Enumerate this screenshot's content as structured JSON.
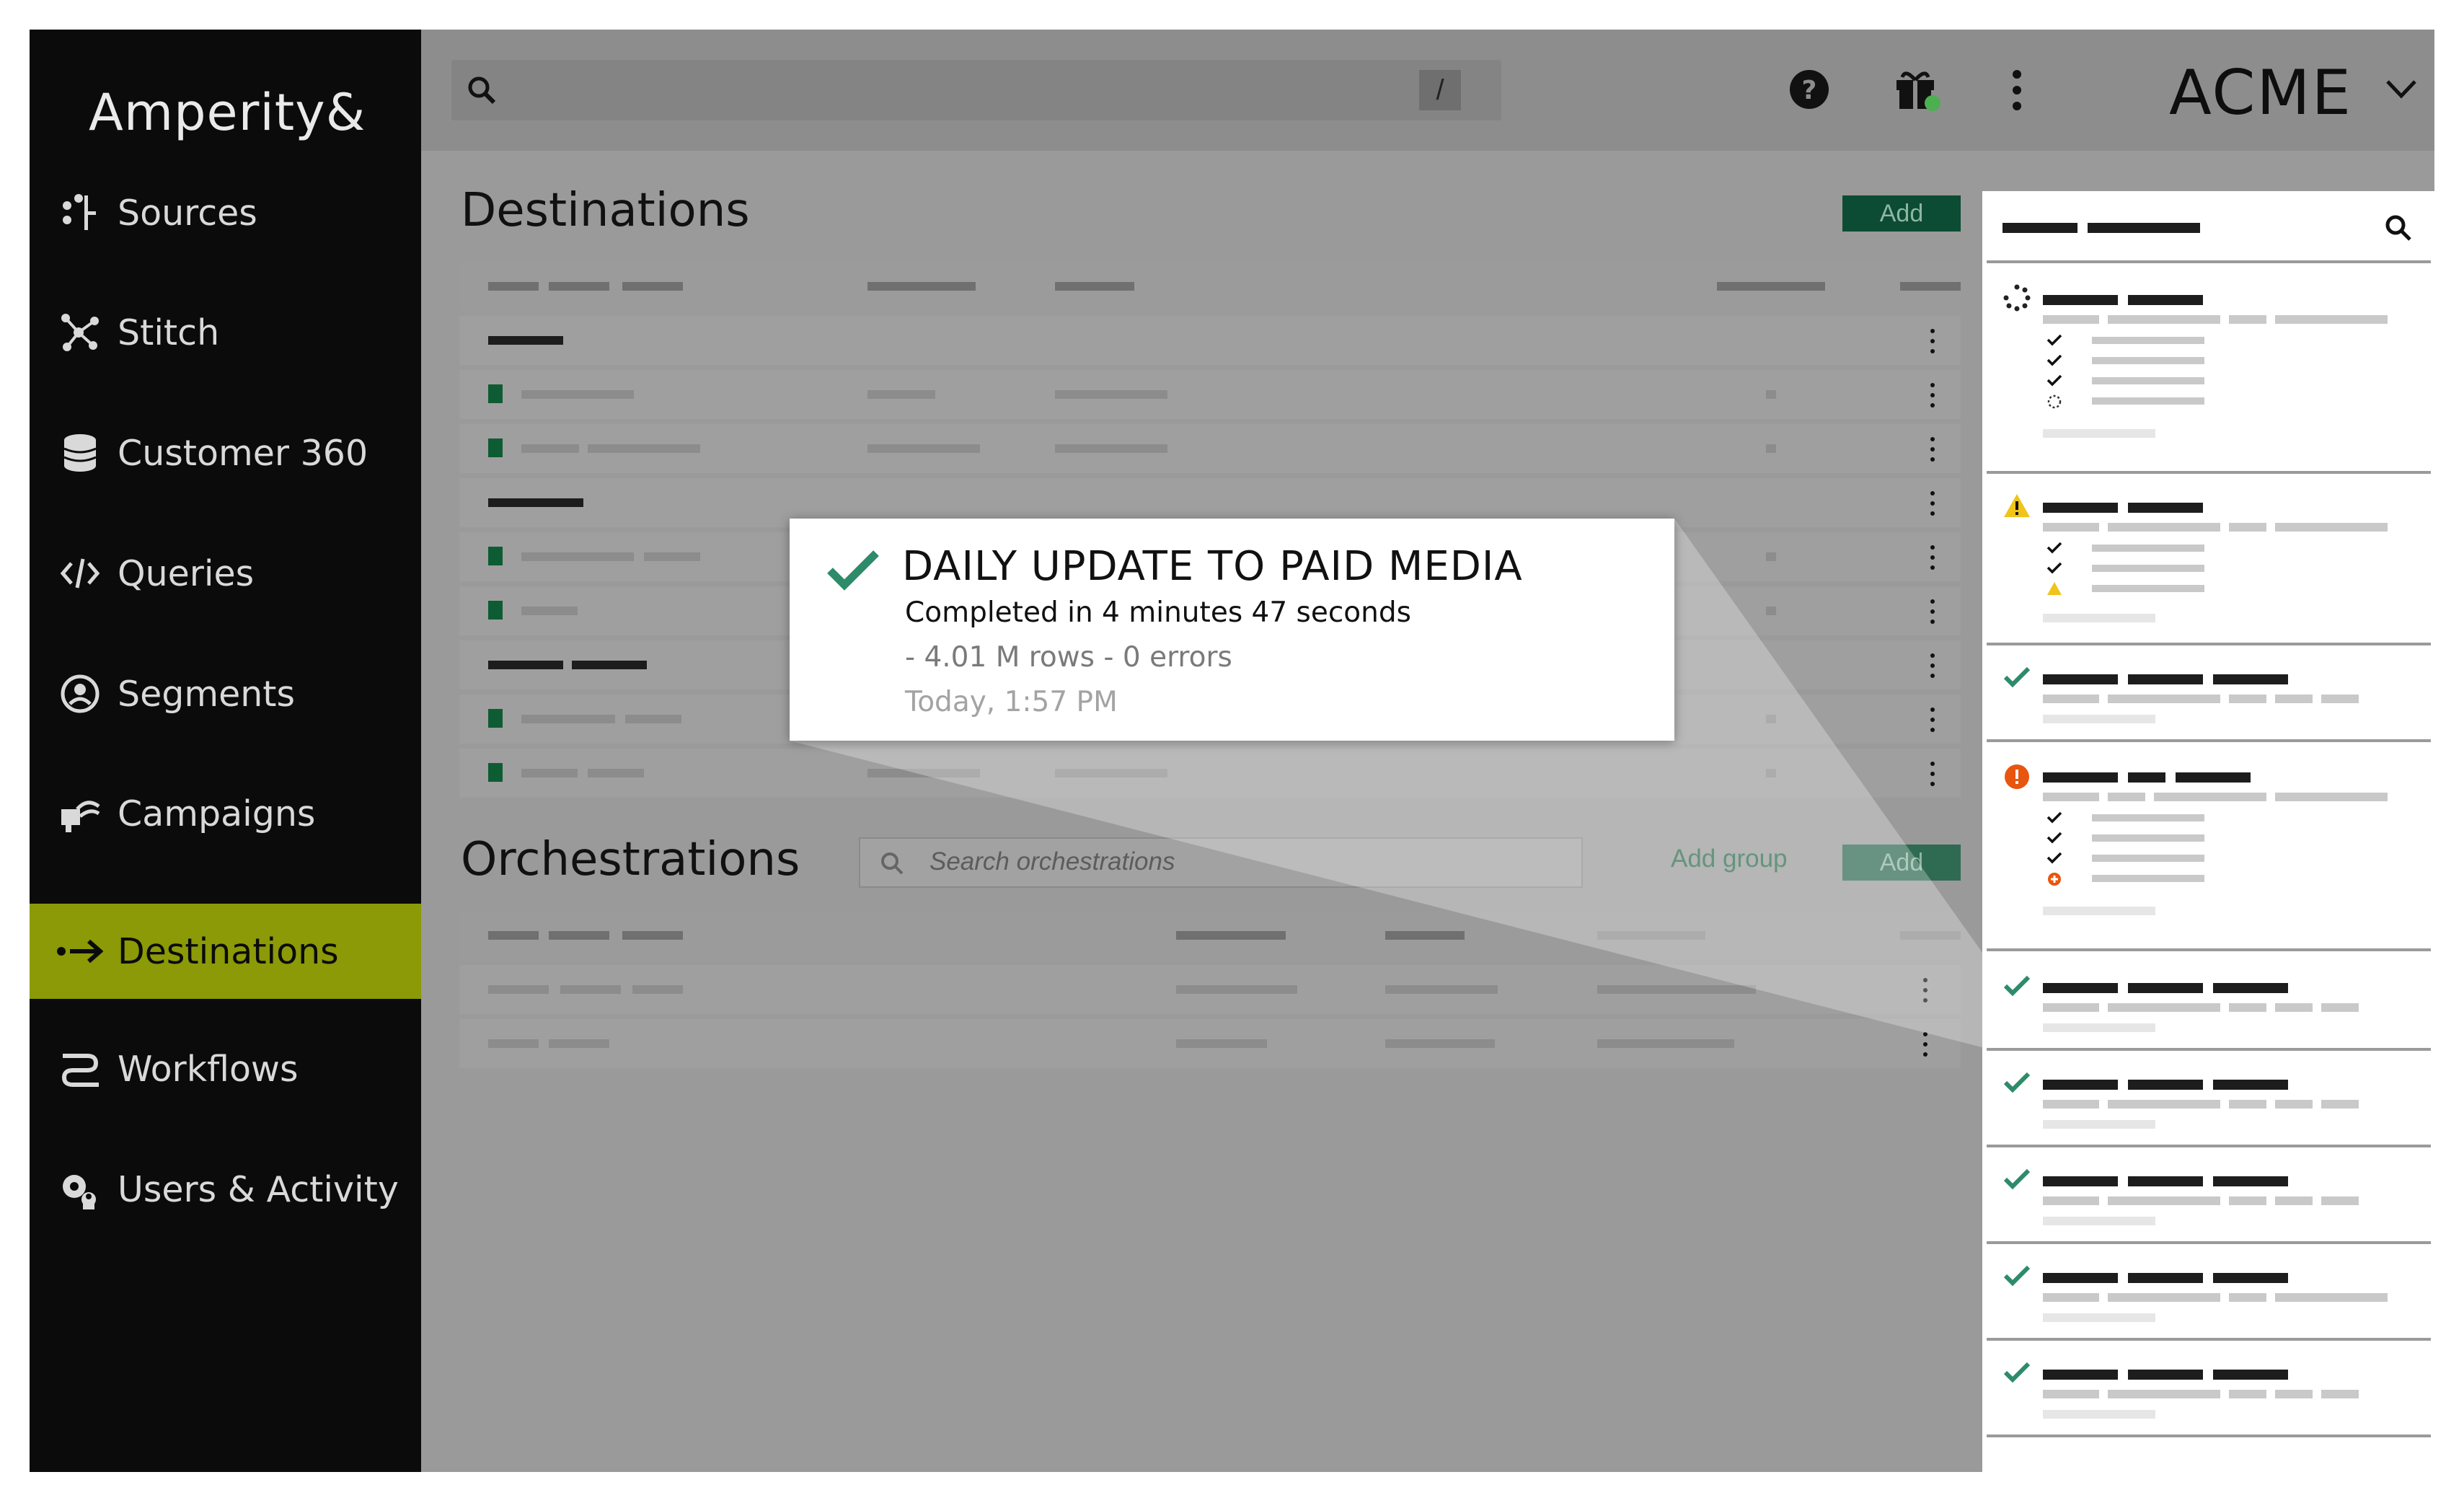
{
  "brand": {
    "logo_text": "Amperity",
    "logo_ampersand": "&"
  },
  "sidebar": {
    "items": [
      {
        "label": "Sources",
        "icon": "sources-icon"
      },
      {
        "label": "Stitch",
        "icon": "stitch-icon"
      },
      {
        "label": "Customer 360",
        "icon": "database-icon"
      },
      {
        "label": "Queries",
        "icon": "code-icon"
      },
      {
        "label": "Segments",
        "icon": "segments-icon"
      },
      {
        "label": "Campaigns",
        "icon": "megaphone-icon"
      },
      {
        "label": "Destinations",
        "icon": "arrow-right-icon",
        "active": true
      },
      {
        "label": "Workflows",
        "icon": "workflow-icon"
      },
      {
        "label": "Users & Activity",
        "icon": "users-gear-icon"
      }
    ],
    "active_color": "#8b9a06"
  },
  "topbar": {
    "search_shortcut": "/",
    "tenant": "ACME",
    "icons": [
      "search-icon",
      "help-icon",
      "gift-icon",
      "more-vertical-icon",
      "chevron-down-icon"
    ]
  },
  "destinations": {
    "title": "Destinations",
    "add_label": "Add"
  },
  "orchestrations": {
    "title": "Orchestrations",
    "search_placeholder": "Search orchestrations",
    "add_group_label": "Add group",
    "add_label": "Add"
  },
  "popup": {
    "title": "DAILY UPDATE TO PAID MEDIA",
    "subtitle": "Completed in 4 minutes 47 seconds",
    "rows_errors": "- 4.01 M rows - 0 errors",
    "timestamp": "Today, 1:57 PM",
    "status_icon": "check-icon"
  },
  "workflow_panel": {
    "cards": [
      {
        "status": "running"
      },
      {
        "status": "warning"
      },
      {
        "status": "success"
      },
      {
        "status": "error"
      },
      {
        "status": "success"
      },
      {
        "status": "success"
      },
      {
        "status": "success"
      },
      {
        "status": "success"
      },
      {
        "status": "success"
      }
    ],
    "colors": {
      "success": "#2e8b6a",
      "warning": "#f0c419",
      "error": "#e8550f"
    }
  }
}
